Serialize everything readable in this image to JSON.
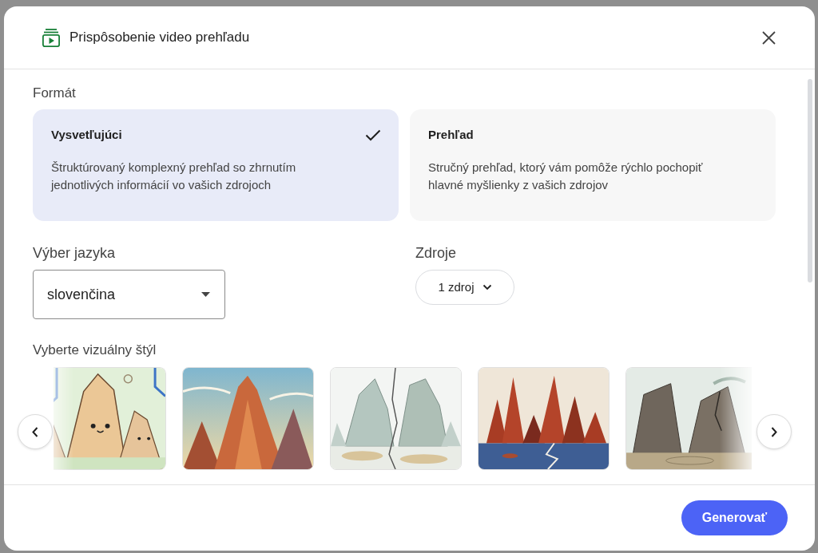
{
  "dialog": {
    "title": "Prispôsobenie video prehľadu"
  },
  "format": {
    "label": "Formát",
    "options": [
      {
        "title": "Vysvetľujúci",
        "description": "Štruktúrovaný komplexný prehľad so zhrnutím jednotlivých informácií vo vašich zdrojoch",
        "selected": true
      },
      {
        "title": "Prehľad",
        "description": "Stručný prehľad, ktorý vám pomôže rýchlo pochopiť hlavné myšlienky z vašich zdrojov",
        "selected": false
      }
    ]
  },
  "language": {
    "label": "Výber jazyka",
    "value": "slovenčina"
  },
  "sources": {
    "label": "Zdroje",
    "value": "1 zdroj"
  },
  "visual_style": {
    "label": "Vyberte vizuálny štýl"
  },
  "footer": {
    "button": "Generovať"
  }
}
